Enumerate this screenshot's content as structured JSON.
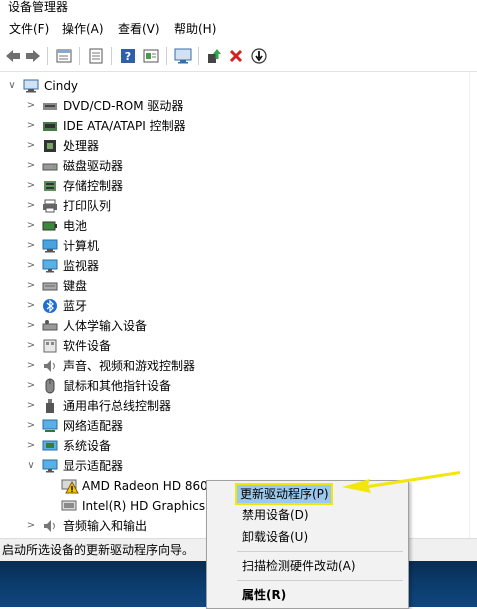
{
  "window": {
    "title": "设备管理器"
  },
  "menu": [
    "文件(F)",
    "操作(A)",
    "查看(V)",
    "帮助(H)"
  ],
  "toolbar": {
    "icons": [
      "back-icon",
      "forward-icon",
      "properties-sheet-icon",
      "show-hidden-icon",
      "help-icon",
      "scan-icon",
      "monitor-icon",
      "update-driver-icon",
      "uninstall-icon",
      "disable-icon"
    ]
  },
  "tree": {
    "root": "Cindy",
    "categories": [
      "DVD/CD-ROM 驱动器",
      "IDE ATA/ATAPI 控制器",
      "处理器",
      "磁盘驱动器",
      "存储控制器",
      "打印队列",
      "电池",
      "计算机",
      "监视器",
      "键盘",
      "蓝牙",
      "人体学输入设备",
      "软件设备",
      "声音、视频和游戏控制器",
      "鼠标和其他指针设备",
      "通用串行总线控制器",
      "网络适配器",
      "系统设备",
      "显示适配器"
    ],
    "display_children": [
      "AMD Radeon HD 860",
      "Intel(R) HD Graphics F"
    ],
    "after": "音频输入和输出"
  },
  "status": "启动所选设备的更新驱动程序向导。",
  "context_menu": {
    "items": [
      "更新驱动程序(P)",
      "禁用设备(D)",
      "卸载设备(U)",
      "扫描检测硬件改动(A)",
      "属性(R)"
    ]
  },
  "colors": {
    "highlight_yellow": "#f2e60c",
    "selection_blue": "#99c9ef",
    "menu_bg": "#f2f2f2"
  }
}
